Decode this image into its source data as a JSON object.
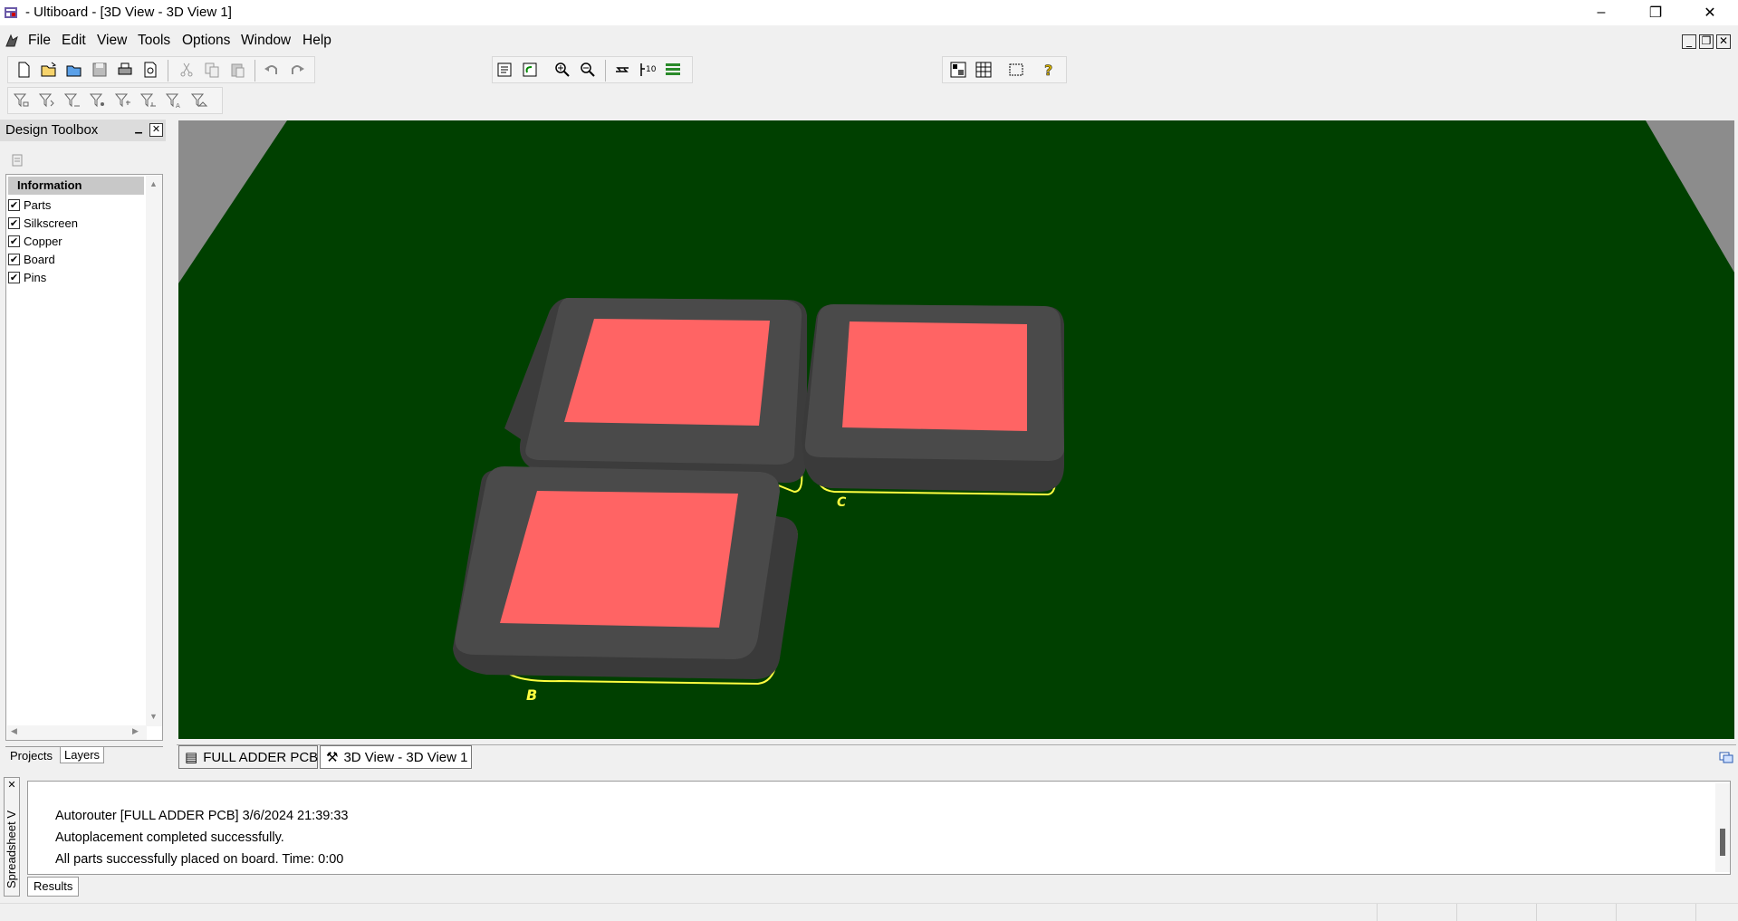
{
  "window": {
    "title": "- Ultiboard - [3D View - 3D View 1]",
    "minimize": "–",
    "restore": "❐",
    "close": "✕"
  },
  "menu": {
    "items": [
      "File",
      "Edit",
      "View",
      "Tools",
      "Options",
      "Window",
      "Help"
    ]
  },
  "toolbox": {
    "title": "Design Toolbox",
    "pin": "▁",
    "close": "✕",
    "section": "Information",
    "layers": [
      {
        "label": "Parts",
        "checked": true
      },
      {
        "label": "Silkscreen",
        "checked": true
      },
      {
        "label": "Copper",
        "checked": true
      },
      {
        "label": "Board",
        "checked": true
      },
      {
        "label": "Pins",
        "checked": true
      }
    ],
    "tabs": [
      "Projects",
      "Layers"
    ],
    "active_tab": "Layers"
  },
  "view3d": {
    "board_color": "#004000",
    "part_body_color": "#4a4a4a",
    "part_top_color": "#ff6464",
    "silk_color": "#ffff40",
    "labels": [
      "B",
      "C"
    ]
  },
  "doc_tabs": [
    {
      "label": "FULL ADDER PCB *",
      "active": false
    },
    {
      "label": "3D View - 3D View 1",
      "active": true
    }
  ],
  "output": {
    "side_label": "Spreadsheet V",
    "close": "✕",
    "lines": [
      "Autorouter [FULL ADDER PCB]  3/6/2024 21:39:33",
      "Autoplacement completed successfully.",
      "All parts successfully placed on board.  Time: 0:00"
    ],
    "tab": "Results"
  }
}
